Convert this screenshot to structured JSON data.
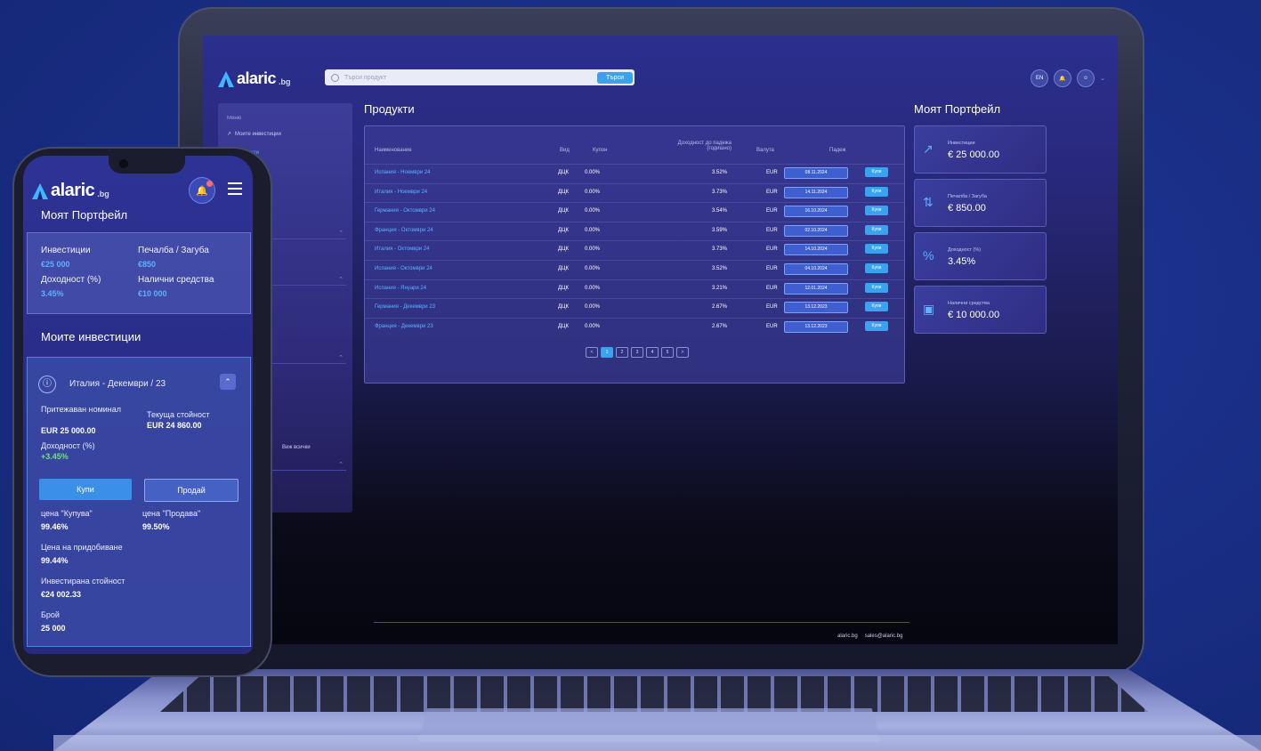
{
  "brand": {
    "name": "alaric",
    "suffix": ".bg"
  },
  "desktop": {
    "search": {
      "placeholder": "Търси продукт",
      "button": "Търси"
    },
    "top_icons": {
      "lang": "EN"
    },
    "sidebar": {
      "menu_label": "Меню",
      "items": [
        "Моите инвестиции",
        "Продукти"
      ],
      "see_all": "Виж всички"
    },
    "products_title": "Продукти",
    "portfolio_title": "Моят Портфейл",
    "table": {
      "headers": [
        "Наименование",
        "Вид",
        "Купон",
        "Доходност до падежа (годишно)",
        "Валута",
        "Падеж"
      ],
      "rows": [
        {
          "name": "Испания - Ноември 24",
          "type": "ДЦК",
          "coupon": "0.00%",
          "yield": "3.52%",
          "cur": "EUR",
          "date": "08.11.2024",
          "buy": "Купи"
        },
        {
          "name": "Италия - Ноември 24",
          "type": "ДЦК",
          "coupon": "0.00%",
          "yield": "3.73%",
          "cur": "EUR",
          "date": "14.11.2024",
          "buy": "Купи"
        },
        {
          "name": "Германия - Октомври 24",
          "type": "ДЦК",
          "coupon": "0.00%",
          "yield": "3.54%",
          "cur": "EUR",
          "date": "16.10.2024",
          "buy": "Купи"
        },
        {
          "name": "Франция - Октомври 24",
          "type": "ДЦК",
          "coupon": "0.00%",
          "yield": "3.59%",
          "cur": "EUR",
          "date": "02.10.2024",
          "buy": "Купи"
        },
        {
          "name": "Италия - Октомври 24",
          "type": "ДЦК",
          "coupon": "0.00%",
          "yield": "3.73%",
          "cur": "EUR",
          "date": "14.10.2024",
          "buy": "Купи"
        },
        {
          "name": "Испания - Октомври 24",
          "type": "ДЦК",
          "coupon": "0.00%",
          "yield": "3.52%",
          "cur": "EUR",
          "date": "04.10.2024",
          "buy": "Купи"
        },
        {
          "name": "Испания - Януари 24",
          "type": "ДЦК",
          "coupon": "0.00%",
          "yield": "3.21%",
          "cur": "EUR",
          "date": "12.01.2024",
          "buy": "Купи"
        },
        {
          "name": "Германия - Декември 23",
          "type": "ДЦК",
          "coupon": "0.00%",
          "yield": "2.67%",
          "cur": "EUR",
          "date": "13.12.2023",
          "buy": "Купи"
        },
        {
          "name": "Франция - Декември 23",
          "type": "ДЦК",
          "coupon": "0.00%",
          "yield": "2.67%",
          "cur": "EUR",
          "date": "13.12.2023",
          "buy": "Купи"
        }
      ]
    },
    "pagination": [
      "<",
      "1",
      "2",
      "3",
      "4",
      "5",
      ">"
    ],
    "portfolio_cards": [
      {
        "label": "Инвестиции",
        "value": "€ 25 000.00",
        "icon": "trend-up-icon"
      },
      {
        "label": "Печалба / Загуба",
        "value": "€ 850.00",
        "icon": "arrows-updown-icon"
      },
      {
        "label": "Доходност (%)",
        "value": "3.45%",
        "icon": "percent-icon"
      },
      {
        "label": "Налични средства",
        "value": "€ 10 000.00",
        "icon": "cash-icon"
      }
    ],
    "footer": {
      "site": "alaric.bg",
      "email": "sales@alaric.bg"
    }
  },
  "mobile": {
    "portfolio_title": "Моят Портфейл",
    "summary": {
      "investments_label": "Инвестиции",
      "investments_value": "€25 000",
      "pl_label": "Печалба / Загуба",
      "pl_value": "€850",
      "yield_label": "Доходност (%)",
      "yield_value": "3.45%",
      "cash_label": "Налични средства",
      "cash_value": "€10 000"
    },
    "my_investments_title": "Моите инвестиции",
    "investment": {
      "title": "Италия - Декември / 23",
      "held_label": "Притежаван номинал",
      "held_value": "EUR 25 000.00",
      "current_label": "Текуща стойност",
      "current_value": "EUR 24 860.00",
      "yield_label": "Доходност (%)",
      "yield_value": "+3.45%",
      "buy_button": "Купи",
      "sell_button": "Продай",
      "buy_price_label": "цена \"Купува\"",
      "buy_price_value": "99.46%",
      "sell_price_label": "цена \"Продава\"",
      "sell_price_value": "99.50%",
      "acq_price_label": "Цена на придобиване",
      "acq_price_value": "99.44%",
      "invested_label": "Инвестирана стойност",
      "invested_value": "€24 002.33",
      "count_label": "Брой",
      "count_value": "25 000"
    }
  }
}
